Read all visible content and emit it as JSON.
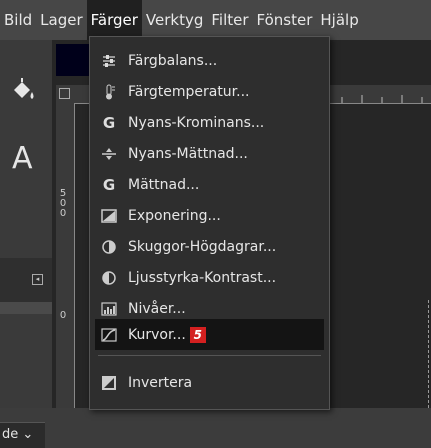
{
  "menubar": {
    "items": [
      {
        "label": "Bild"
      },
      {
        "label": "Lager"
      },
      {
        "label": "Färger",
        "active": true
      },
      {
        "label": "Verktyg"
      },
      {
        "label": "Filter"
      },
      {
        "label": "Fönster"
      },
      {
        "label": "Hjälp"
      }
    ]
  },
  "toolbox": {
    "text_tool_glyph": "A",
    "mode_label": "de"
  },
  "rulers": {
    "left_ticks": [
      "5",
      "0",
      "0"
    ],
    "left_tick2": "0"
  },
  "menu": {
    "items": [
      {
        "label": "Färgbalans...",
        "icon": "color-balance-icon"
      },
      {
        "label": "Färgtemperatur...",
        "icon": "thermometer-icon"
      },
      {
        "label": "Nyans-Krominans...",
        "icon": "gegl-g-icon"
      },
      {
        "label": "Nyans-Mättnad...",
        "icon": "hue-saturation-icon"
      },
      {
        "label": "Mättnad...",
        "icon": "gegl-g-icon"
      },
      {
        "label": "Exponering...",
        "icon": "exposure-icon"
      },
      {
        "label": "Skuggor-Högdagrar...",
        "icon": "shadows-highlights-icon"
      },
      {
        "label": "Ljusstyrka-Kontrast...",
        "icon": "brightness-contrast-icon"
      },
      {
        "label": "Nivåer...",
        "icon": "levels-icon"
      },
      {
        "label": "Kurvor...",
        "icon": "curves-icon",
        "highlighted": true,
        "badge": "5"
      },
      {
        "label": "Invertera",
        "icon": "invert-icon"
      }
    ]
  },
  "colors": {
    "highlight": "#141414",
    "badge": "#d42020",
    "menu_bg": "#2e2e2e"
  }
}
